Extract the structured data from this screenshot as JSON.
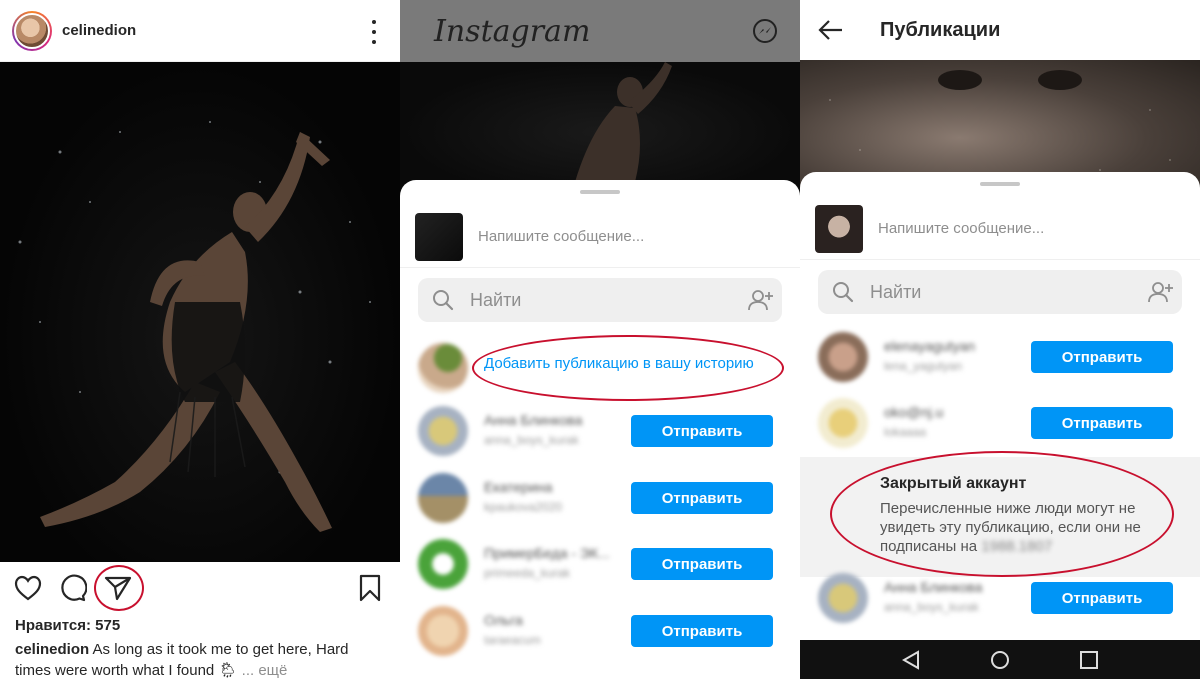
{
  "panel1": {
    "username": "celinedion",
    "likes": "Нравится: 575",
    "caption": {
      "user": "celinedion",
      "text": "As long as it took me to get here, Hard times were worth what I found",
      "more": "... ещё"
    },
    "icons": [
      "heart-icon",
      "comment-icon",
      "share-icon",
      "bookmark-icon",
      "more-icon"
    ]
  },
  "panel2": {
    "logo": "Instagram",
    "message_placeholder": "Напишите сообщение...",
    "search_placeholder": "Найти",
    "add_to_story": "Добавить публикацию в вашу историю",
    "send_label": "Отправить",
    "contacts": [
      {
        "name": "Анна Блинкова",
        "user": "anna_boys_kurak"
      },
      {
        "name": "Екатерина",
        "user": "kpaukova2020"
      },
      {
        "name": "ПримерБеда - ЭК...",
        "user": "primeeda_kurak"
      },
      {
        "name": "Ольга",
        "user": "taraeacum"
      }
    ]
  },
  "panel3": {
    "title": "Публикации",
    "message_placeholder": "Напишите сообщение...",
    "search_placeholder": "Найти",
    "send_label": "Отправить",
    "contacts": [
      {
        "name": "elenayagutyan",
        "user": "lena_yagutyan"
      },
      {
        "name": "oko@nj.u",
        "user": "lokaaaa"
      },
      {
        "name": "Анна Блинкова",
        "user": "anna_boys_kurak"
      }
    ],
    "private_title": "Закрытый аккаунт",
    "private_text": "Перечисленные ниже люди могут не увидеть эту публикацию, если они не подписаны на",
    "private_handle": "1988.1807"
  },
  "colors": {
    "accent": "#0095f6",
    "annotation": "#c8102e"
  }
}
